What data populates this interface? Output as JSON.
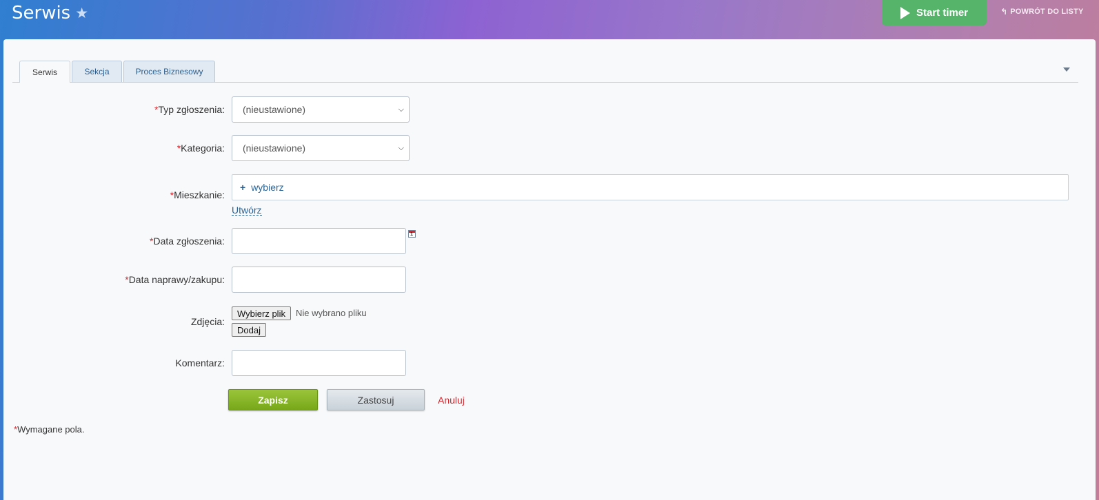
{
  "header": {
    "title": "Serwis",
    "start_timer_label": "Start timer",
    "back_label": "POWRÓT DO LISTY",
    "back_icon": "↰"
  },
  "tabs": [
    {
      "label": "Serwis",
      "active": true
    },
    {
      "label": "Sekcja",
      "active": false
    },
    {
      "label": "Proces Biznesowy",
      "active": false
    }
  ],
  "form": {
    "required_mark": "*",
    "typ": {
      "label": "Typ zgłoszenia:",
      "value": "(nieustawione)"
    },
    "kategoria": {
      "label": "Kategoria:",
      "value": "(nieustawione)"
    },
    "mieszkanie": {
      "label": "Mieszkanie:",
      "select_link": "wybierz",
      "create_link": "Utwórz"
    },
    "data_zgloszenia": {
      "label": "Data zgłoszenia:",
      "value": "",
      "calendar_day": "1"
    },
    "data_naprawy": {
      "label": "Data naprawy/zakupu:",
      "value": ""
    },
    "zdjecia": {
      "label": "Zdjęcia:",
      "file_button": "Wybierz plik",
      "file_status": "Nie wybrano pliku",
      "add_button": "Dodaj"
    },
    "komentarz": {
      "label": "Komentarz:",
      "value": ""
    }
  },
  "actions": {
    "save": "Zapisz",
    "apply": "Zastosuj",
    "cancel": "Anuluj"
  },
  "required_note": "Wymagane pola.",
  "colors": {
    "accent_green": "#56b36a",
    "save_green": "#78a71a",
    "required_red": "#d9262c",
    "link_blue": "#2a6496"
  }
}
